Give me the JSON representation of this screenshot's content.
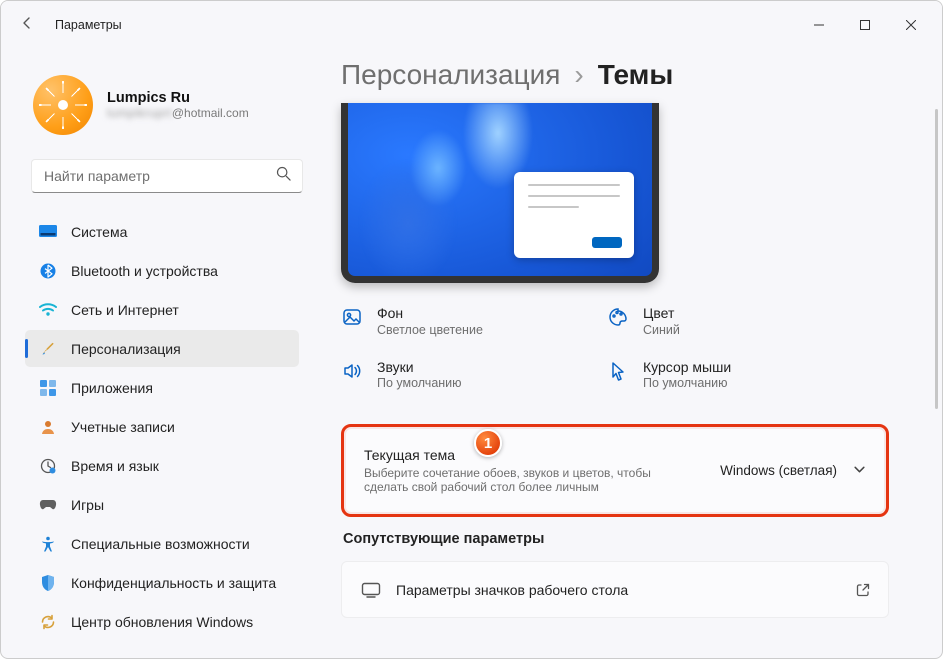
{
  "window": {
    "title": "Параметры"
  },
  "account": {
    "name": "Lumpics Ru",
    "email_hidden": "lumpikruprt",
    "email_domain": "@hotmail.com"
  },
  "search": {
    "placeholder": "Найти параметр"
  },
  "nav": {
    "items": [
      {
        "label": "Система"
      },
      {
        "label": "Bluetooth и устройства"
      },
      {
        "label": "Сеть и Интернет"
      },
      {
        "label": "Персонализация"
      },
      {
        "label": "Приложения"
      },
      {
        "label": "Учетные записи"
      },
      {
        "label": "Время и язык"
      },
      {
        "label": "Игры"
      },
      {
        "label": "Специальные возможности"
      },
      {
        "label": "Конфиденциальность и защита"
      },
      {
        "label": "Центр обновления Windows"
      }
    ]
  },
  "breadcrumb": {
    "root": "Персонализация",
    "leaf": "Темы"
  },
  "theme_props": {
    "background": {
      "title": "Фон",
      "value": "Светлое цветение"
    },
    "color": {
      "title": "Цвет",
      "value": "Синий"
    },
    "sounds": {
      "title": "Звуки",
      "value": "По умолчанию"
    },
    "cursor": {
      "title": "Курсор мыши",
      "value": "По умолчанию"
    }
  },
  "current_theme": {
    "title": "Текущая тема",
    "desc": "Выберите сочетание обоев, звуков и цветов, чтобы сделать свой рабочий стол более личным",
    "value": "Windows (светлая)"
  },
  "related": {
    "section": "Сопутствующие параметры",
    "desktop_icons": "Параметры значков рабочего стола"
  },
  "marker1": "1"
}
